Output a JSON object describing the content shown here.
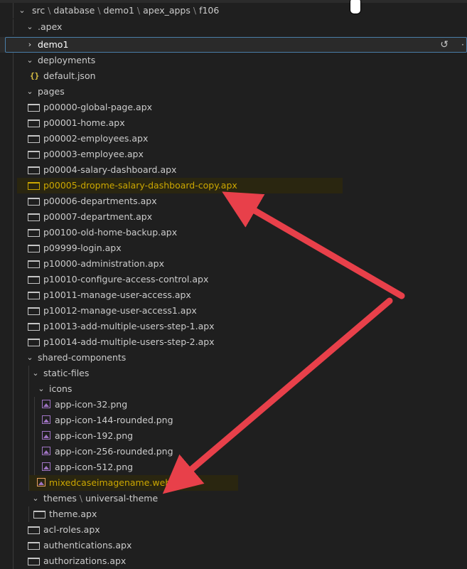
{
  "breadcrumb": {
    "parts": [
      "src",
      "database",
      "demo1",
      "apex_apps",
      "f106"
    ]
  },
  "tree": {
    "apex_folder": ".apex",
    "apex_child_partial": "",
    "demo1": "demo1",
    "deployments": "deployments",
    "default_json": "default.json",
    "pages": "pages",
    "page_files": [
      "p00000-global-page.apx",
      "p00001-home.apx",
      "p00002-employees.apx",
      "p00003-employee.apx",
      "p00004-salary-dashboard.apx",
      "p00005-dropme-salary-dashboard-copy.apx",
      "p00006-departments.apx",
      "p00007-department.apx",
      "p00100-old-home-backup.apx",
      "p09999-login.apx",
      "p10000-administration.apx",
      "p10010-configure-access-control.apx",
      "p10011-manage-user-access.apx",
      "p10012-manage-user-access1.apx",
      "p10013-add-multiple-users-step-1.apx",
      "p10014-add-multiple-users-step-2.apx"
    ],
    "shared_components": "shared-components",
    "static_files": "static-files",
    "icons": "icons",
    "icon_files": [
      "app-icon-32.png",
      "app-icon-144-rounded.png",
      "app-icon-192.png",
      "app-icon-256-rounded.png",
      "app-icon-512.png"
    ],
    "webp_file": "mixedcaseimagename.webp",
    "themes": "themes",
    "universal_theme": "universal-theme",
    "theme_file": "theme.apx",
    "root_files": [
      "acl-roles.apx",
      "authentications.apx",
      "authorizations.apx"
    ]
  },
  "colors": {
    "background": "#1f1f1f",
    "text": "#cccccc",
    "warning_text": "#cca700",
    "arrow": "#e8404a",
    "image_icon": "#a074c4",
    "json_icon": "#e0c545"
  },
  "icons": {
    "chevron_down": "⌄",
    "chevron_right": "›",
    "undo": "↺",
    "json": "{ }"
  }
}
